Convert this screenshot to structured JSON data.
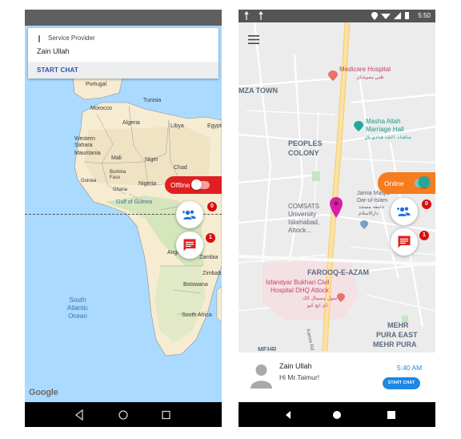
{
  "left": {
    "card": {
      "role": "Service Provider",
      "name": "Zain Ullah",
      "action": "START CHAT"
    },
    "status_toggle": "Offline",
    "badges": {
      "add_user": "0",
      "messages": "1"
    },
    "map_labels": {
      "portugal": "Portugal",
      "tunisia": "Tunisia",
      "morocco": "Morocco",
      "algeria": "Algeria",
      "libya": "Libya",
      "egypt": "Egypt",
      "western_sahara": "Western Sahara",
      "mauritania": "Mauritania",
      "mali": "Mali",
      "niger": "Niger",
      "chad": "Chad",
      "burkina_faso": "Burkina Faso",
      "guinea": "Guinea",
      "ghana": "Ghana",
      "nigeria": "Nigeria",
      "gulf_of_guinea": "Gulf of Guinea",
      "angola": "Angola",
      "zambia": "Zambia",
      "zimbabwe": "Zimbab",
      "botswana": "Botswana",
      "south_africa": "South Africa",
      "ocean_line1": "South",
      "ocean_line2": "Atlantic",
      "ocean_line3": "Ocean",
      "google": "Google"
    }
  },
  "right": {
    "status_time": "5:50",
    "status_toggle": "Online",
    "badges": {
      "add_user": "0",
      "messages": "1"
    },
    "places": {
      "medicare": "Medicare Hospital",
      "medicare_ur": "طبی ہسپتال",
      "mza_town": "MZA TOWN",
      "masha_allah_1": "Masha Allah",
      "masha_allah_2": "Marriage Hall",
      "masha_allah_ur": "ماشاء اللہ شادی ہال",
      "peoples_1": "PEOPLES",
      "peoples_2": "COLONY",
      "jamia_1": "Jamia Masjid",
      "jamia_2": "Dar-ul-Islam",
      "jamia_ur1": "جامعہ مسجد",
      "jamia_ur2": "دارالاسلام",
      "comsats_1": "COMSATS",
      "comsats_2": "University",
      "comsats_3": "Islamabad,",
      "comsats_4": "Attock...",
      "farooq": "FAROOQ-E-AZAM",
      "isfandyar_1": "Isfandyar Bukhari Civil",
      "isfandyar_2": "Hospital DHQ Attock",
      "isfandyar_ur1": "سول ہسپتال اٹک",
      "isfandyar_ur2": "ڈی ایچ کیو",
      "kamra": "Kamra Rd",
      "mehr_1": "MEHR",
      "mehr_2": "PURA EAST",
      "mehr_3": "MEHR PURA",
      "mehr_cut": "MEHR"
    },
    "chat": {
      "name": "Zain Ullah",
      "message": "Hi  Mr.Taimur!",
      "time": "5:40 AM",
      "action": "START CHAT"
    }
  },
  "colors": {
    "offline_red": "#e02020",
    "online_orange": "#f57c1f",
    "accent_blue": "#1e88e5",
    "badge_red": "#d90e0e",
    "teal": "#26a69a"
  }
}
